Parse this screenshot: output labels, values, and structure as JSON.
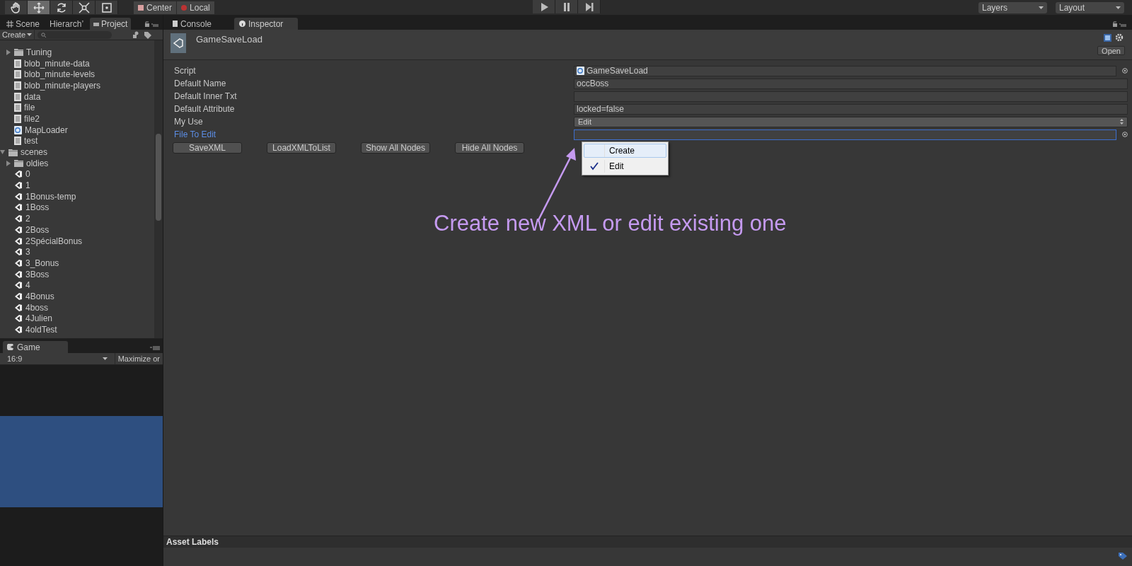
{
  "toolbar": {
    "tools": [
      {
        "kind": "hand",
        "selected": false
      },
      {
        "kind": "move",
        "selected": true
      },
      {
        "kind": "rotate",
        "selected": false
      },
      {
        "kind": "scale",
        "selected": false
      },
      {
        "kind": "rect",
        "selected": false
      }
    ],
    "pivot": [
      {
        "kind": "center",
        "label": "Center"
      },
      {
        "kind": "local",
        "label": "Local"
      }
    ],
    "play": [
      {
        "kind": "play"
      },
      {
        "kind": "pause"
      },
      {
        "kind": "step"
      }
    ],
    "dropdowns": [
      "Layers",
      "Layout"
    ]
  },
  "left_tabs": [
    {
      "kind": "scene",
      "label": "Scene",
      "selected": false
    },
    {
      "kind": "plain",
      "label": "Hierarch’",
      "selected": false
    },
    {
      "kind": "project",
      "label": "Project",
      "selected": true
    }
  ],
  "project": {
    "create": "Create",
    "tree": [
      {
        "children": [
          {
            "kind": "folder",
            "label": "Tuning",
            "expanded": false
          },
          {
            "kind": "text",
            "label": "blob_minute-data"
          },
          {
            "kind": "text",
            "label": "blob_minute-levels"
          },
          {
            "kind": "text",
            "label": "blob_minute-players"
          },
          {
            "kind": "text",
            "label": "data"
          },
          {
            "kind": "text",
            "label": "file"
          },
          {
            "kind": "text",
            "label": "file2"
          },
          {
            "kind": "script",
            "label": "MapLoader"
          },
          {
            "kind": "text",
            "label": "test"
          }
        ]
      },
      {
        "kind": "folder",
        "label": "scenes",
        "expanded": true,
        "children": [
          {
            "kind": "folder",
            "label": "oldies",
            "expanded": false
          },
          {
            "kind": "scene",
            "label": "0"
          },
          {
            "kind": "scene",
            "label": "1"
          },
          {
            "kind": "scene",
            "label": "1Bonus-temp"
          },
          {
            "kind": "scene",
            "label": "1Boss"
          },
          {
            "kind": "scene",
            "label": "2"
          },
          {
            "kind": "scene",
            "label": "2Boss"
          },
          {
            "kind": "scene",
            "label": "2SpécialBonus"
          },
          {
            "kind": "scene",
            "label": "3"
          },
          {
            "kind": "scene",
            "label": "3_Bonus"
          },
          {
            "kind": "scene",
            "label": "3Boss"
          },
          {
            "kind": "scene",
            "label": "4"
          },
          {
            "kind": "scene",
            "label": "4Bonus"
          },
          {
            "kind": "scene",
            "label": "4boss"
          },
          {
            "kind": "scene",
            "label": "4Julien"
          },
          {
            "kind": "scene",
            "label": "4oldTest"
          }
        ]
      }
    ]
  },
  "game": {
    "tab": "Game",
    "aspect": "16:9",
    "maximize": "Maximize or"
  },
  "right_tabs": [
    {
      "kind": "console",
      "label": "Console",
      "selected": false
    },
    {
      "kind": "inspector",
      "label": "Inspector",
      "selected": true
    }
  ],
  "inspector": {
    "title": "GameSaveLoad",
    "open": "Open",
    "properties": [
      {
        "label": "Script",
        "kind": "object",
        "value": "GameSaveLoad",
        "focused": false
      },
      {
        "label": "Default Name",
        "kind": "text",
        "value": "occBoss",
        "focused": false
      },
      {
        "label": "Default Inner Txt",
        "kind": "text",
        "focused": false
      },
      {
        "label": "Default Attribute",
        "kind": "text",
        "value": "locked=false",
        "focused": false
      },
      {
        "label": "My Use",
        "kind": "dropdown",
        "value": "Edit",
        "focused": false
      },
      {
        "label": "File To Edit",
        "kind": "object",
        "focused": true
      }
    ],
    "buttons": [
      "SaveXML",
      "LoadXMLToList",
      "Show All Nodes",
      "Hide All Nodes"
    ],
    "menu": [
      {
        "label": "Create",
        "selected": false,
        "hovered": true
      },
      {
        "label": "Edit",
        "selected": true,
        "hovered": false
      }
    ],
    "annotation": "Create new XML or edit existing one",
    "asset_labels": "Asset Labels"
  }
}
